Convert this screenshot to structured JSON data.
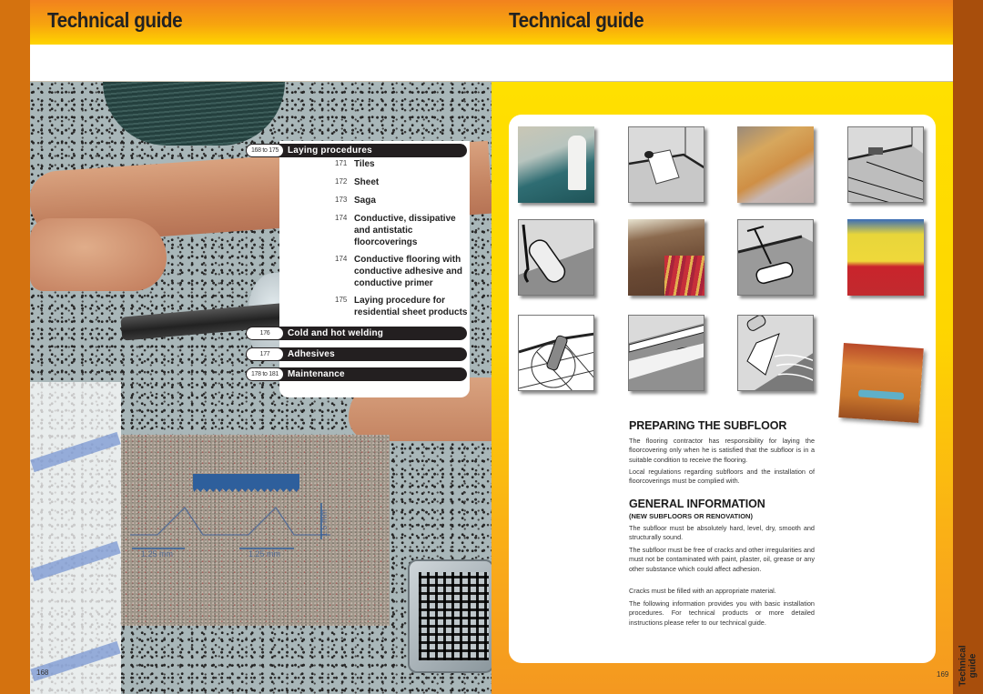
{
  "header": {
    "left_title": "Technical guide",
    "right_title": "Technical guide"
  },
  "left_page": {
    "page_number": "168",
    "toc": {
      "sections": [
        {
          "pages": "168 to 175",
          "label": "Laying procedures",
          "items": [
            {
              "page": "171",
              "label": "Tiles"
            },
            {
              "page": "172",
              "label": "Sheet"
            },
            {
              "page": "173",
              "label": "Saga"
            },
            {
              "page": "174",
              "label": "Conductive, dissipative and antistatic floorcoverings"
            },
            {
              "page": "174",
              "label": "Conductive flooring with conductive adhesive and conductive primer"
            },
            {
              "page": "175",
              "label": "Laying procedure for residential sheet products"
            }
          ]
        },
        {
          "pages": "176",
          "label": "Cold and hot welding"
        },
        {
          "pages": "177",
          "label": "Adhesives"
        },
        {
          "pages": "178 to 181",
          "label": "Maintenance"
        }
      ]
    },
    "diagram_labels": [
      "1.25 mm",
      "1.25 mm",
      "1.5 mm"
    ]
  },
  "right_page": {
    "page_number": "169",
    "side_tab": "Technical guide",
    "thumbnails": [
      {
        "kind": "photo",
        "subject": "bedroom-floor"
      },
      {
        "kind": "drawing",
        "subject": "sheet-roll"
      },
      {
        "kind": "photo",
        "subject": "inlaid-floor"
      },
      {
        "kind": "drawing",
        "subject": "tile-laying"
      },
      {
        "kind": "drawing",
        "subject": "primer-roller"
      },
      {
        "kind": "photo",
        "subject": "shop-floor"
      },
      {
        "kind": "drawing",
        "subject": "floor-roller"
      },
      {
        "kind": "photo",
        "subject": "colored-floor"
      },
      {
        "kind": "drawing",
        "subject": "welding-gun"
      },
      {
        "kind": "drawing",
        "subject": "coved-skirting"
      },
      {
        "kind": "drawing",
        "subject": "adhesive-trowel"
      },
      {
        "kind": "photo",
        "subject": "restaurant"
      }
    ],
    "preparing": {
      "heading": "PREPARING THE SUBFLOOR",
      "paragraphs": [
        "The flooring contractor has responsibility for laying the floorcovering only when he is satisfied that the subfloor is in a suitable condition to receive the flooring.",
        "Local regulations regarding subfloors and the installation of floorcoverings must be complied with."
      ]
    },
    "general": {
      "heading": "GENERAL INFORMATION",
      "subheading": "(NEW SUBFLOORS OR RENOVATION)",
      "paragraphs": [
        "The subfloor must be absolutely hard, level, dry, smooth and structurally sound.",
        "The subfloor must be free of cracks and other irregularities and must not be contaminated with paint, plaster, oil, grease or any other substance which could affect adhesion.",
        "Cracks must be filled with an appropriate material.",
        "The following information provides you with basic installation procedures. For technical products or more detailed instructions please refer to our technical guide."
      ]
    }
  }
}
